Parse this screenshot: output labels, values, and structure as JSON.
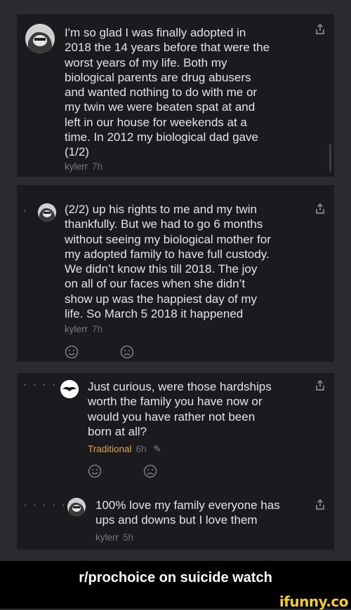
{
  "comments": [
    {
      "lines": [
        "I'm so glad I was finally adopted in",
        "2018 the 14 years before that were the",
        "worst years of my life. Both my",
        "biological parents are drug abusers",
        "and wanted nothing to do with me or",
        "my twin we were beaten spat at and",
        "left in our house for weekends at a",
        "time. In 2012 my biological dad gave",
        "(1/2)"
      ],
      "author": "kylerr",
      "time": "7h"
    },
    {
      "lines": [
        "(2/2) up his rights to me and my twin",
        "thankfully. But we had to go 6 months",
        "without seeing my biological mother for",
        "my adopted family to have full custody.",
        "We didn’t know this till 2018. The joy",
        "on all of our faces when she didn’t",
        "show up was the happiest day of my",
        "life. So March 5 2018 it happened"
      ],
      "author": "kylerr",
      "time": "7h"
    },
    {
      "lines": [
        "Just curious, were those hardships",
        "worth the family you have now or",
        "would you have rather not been",
        "born at all?"
      ],
      "author": "Traditional",
      "time": "6h"
    },
    {
      "lines": [
        "100% love my family everyone has",
        "ups and downs but I love them"
      ],
      "author": "kylerr",
      "time": "5h"
    }
  ],
  "caption": "r/prochoice on suicide watch",
  "watermark": "ifunny.co",
  "colors": {
    "flair": "#d9a441",
    "watermark": "#f3cb2a"
  },
  "icons": [
    "share-icon",
    "smile-icon",
    "frown-icon",
    "pencil-icon",
    "avatar"
  ]
}
